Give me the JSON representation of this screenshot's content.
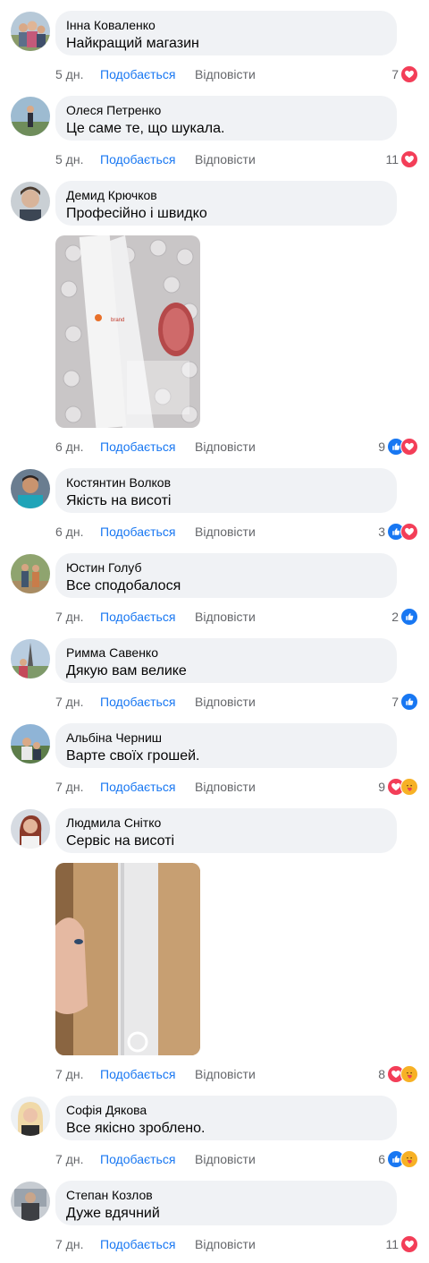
{
  "actions": {
    "like_label": "Подобається",
    "reply_label": "Відповісти"
  },
  "colors": {
    "accent": "#1877f2",
    "heart": "#f33e58",
    "care": "#f7b125",
    "bubble": "#f0f2f5",
    "meta": "#65676b"
  },
  "comments": [
    {
      "name": "Інна Коваленко",
      "text": "Найкращий магазин",
      "time": "5 дн.",
      "count": "7",
      "reactions": [
        "heart-icon"
      ]
    },
    {
      "name": "Олеся Петренко",
      "text": "Це саме те, що шукала.",
      "time": "5 дн.",
      "count": "11",
      "reactions": [
        "heart-icon"
      ]
    },
    {
      "name": "Демид Крючков",
      "text": "Професійно і швидко",
      "time": "6 дн.",
      "count": "9",
      "reactions": [
        "thumbs-up-icon",
        "heart-icon"
      ]
    },
    {
      "name": "Костянтин Волков",
      "text": "Якість на висоті",
      "time": "6 дн.",
      "count": "3",
      "reactions": [
        "thumbs-up-icon",
        "heart-icon"
      ]
    },
    {
      "name": "Юстин Голуб",
      "text": "Все сподобалося",
      "time": "7 дн.",
      "count": "2",
      "reactions": [
        "thumbs-up-icon"
      ]
    },
    {
      "name": "Римма Савенко",
      "text": "Дякую вам велике",
      "time": "7 дн.",
      "count": "7",
      "reactions": [
        "thumbs-up-icon"
      ]
    },
    {
      "name": "Альбіна Черниш",
      "text": "Варте своїх грошей.",
      "time": "7 дн.",
      "count": "9",
      "reactions": [
        "heart-icon",
        "care-icon"
      ]
    },
    {
      "name": "Людмила Снітко",
      "text": "Сервіс на висоті",
      "time": "7 дн.",
      "count": "8",
      "reactions": [
        "heart-icon",
        "care-icon"
      ]
    },
    {
      "name": "Софія Дякова",
      "text": "Все якісно зроблено.",
      "time": "7 дн.",
      "count": "6",
      "reactions": [
        "thumbs-up-icon",
        "care-icon"
      ]
    },
    {
      "name": "Степан Козлов",
      "text": "Дуже вдячний",
      "time": "7 дн.",
      "count": "11",
      "reactions": [
        "heart-icon"
      ]
    }
  ]
}
